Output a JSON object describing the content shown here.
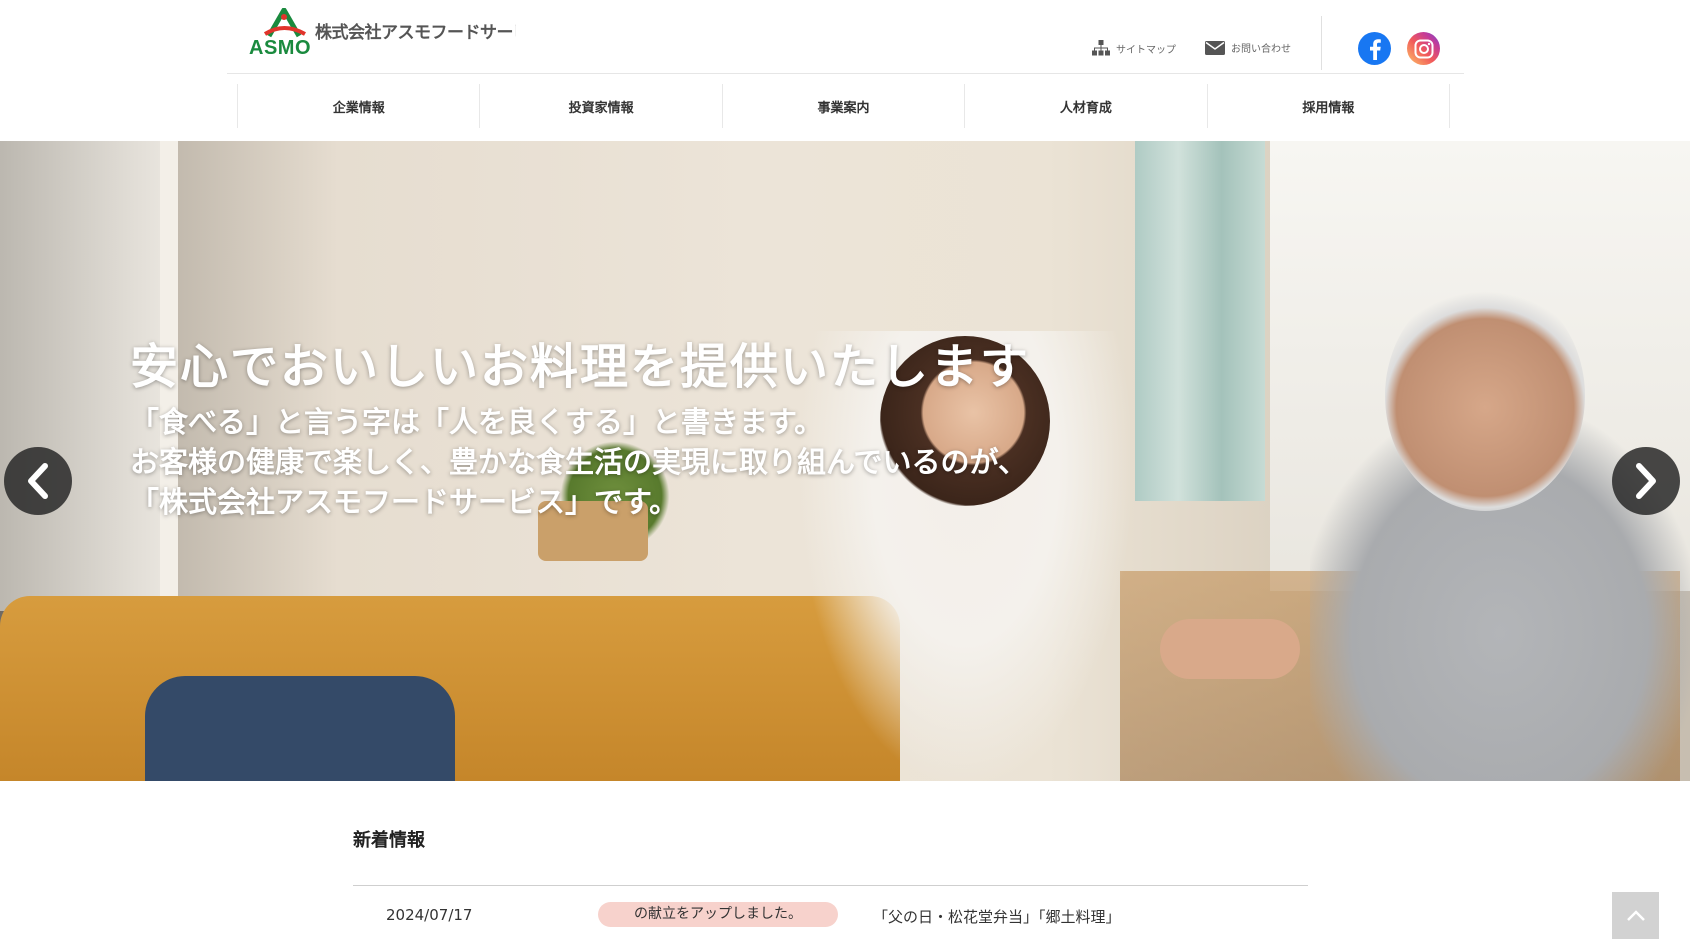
{
  "header": {
    "logo_text": "ASMO",
    "company_name": "株式会社アスモフードサービス",
    "utility": {
      "sitemap_label": "サイトマップ",
      "contact_label": "お問い合わせ"
    },
    "social": {
      "facebook_icon": "facebook-icon",
      "instagram_icon": "instagram-icon"
    },
    "colors": {
      "logo_green": "#1a8a3e",
      "logo_red": "#e0342b",
      "facebook_blue": "#1877f2"
    }
  },
  "nav": {
    "items": [
      {
        "label": "企業情報"
      },
      {
        "label": "投資家情報"
      },
      {
        "label": "事業案内"
      },
      {
        "label": "人材育成"
      },
      {
        "label": "採用情報"
      }
    ]
  },
  "hero": {
    "title": "安心でおいしいお料理を提供いたします",
    "line1": "「食べる」と言う字は「人を良くする」と書きます。",
    "line2": "お客様の健康で楽しく、豊かな食生活の実現に取り組んでいるのが、",
    "line3": "「株式会社アスモフードサービス」です。",
    "prev_icon": "chevron-left-icon",
    "next_icon": "chevron-right-icon"
  },
  "news": {
    "heading": "新着情報",
    "items": [
      {
        "date": "2024/07/17",
        "tag": "の献立をアップしました。",
        "text": "「父の日・松花堂弁当」「郷土料理」"
      }
    ],
    "tag_color": "#f7d2cc"
  },
  "page_top_icon": "chevron-up-icon"
}
